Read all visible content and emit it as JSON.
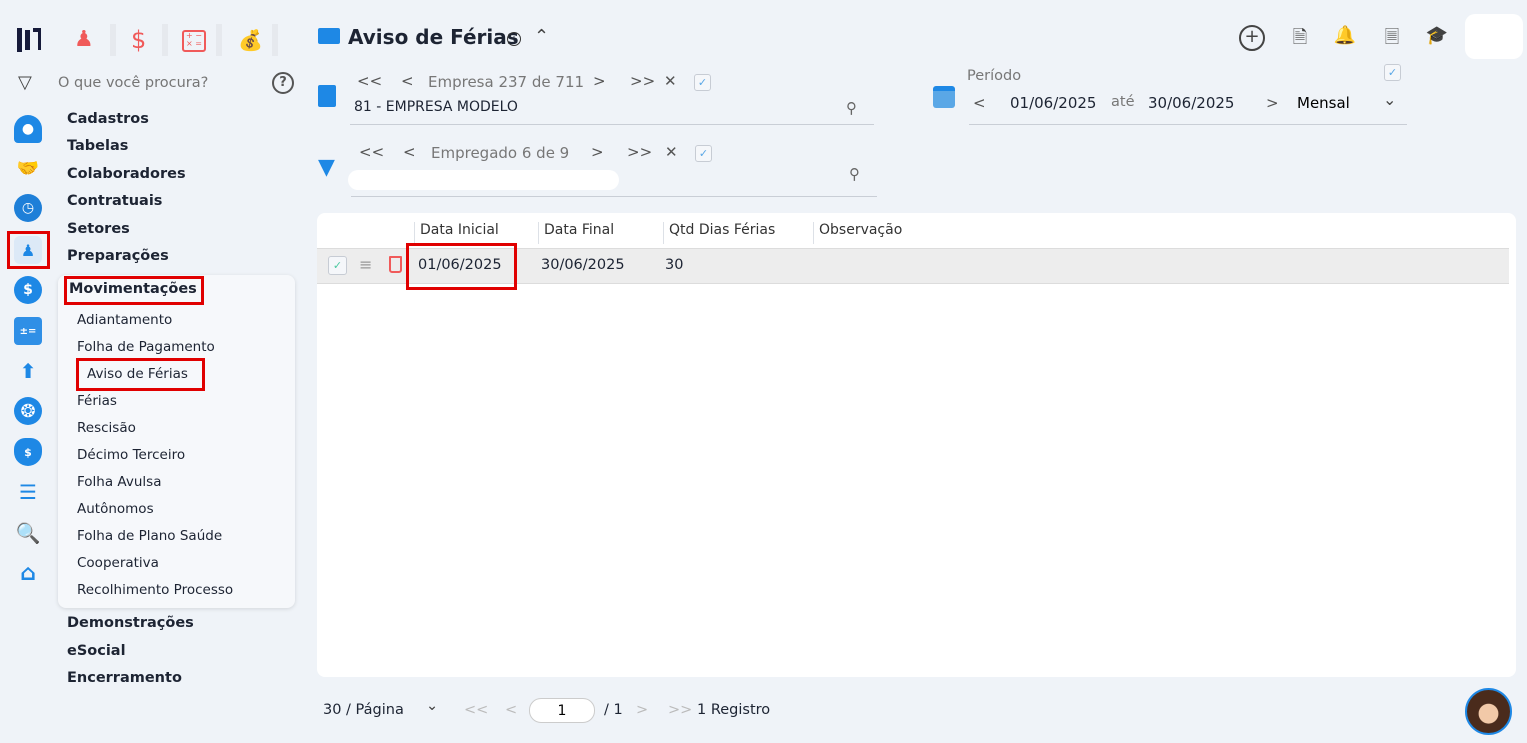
{
  "top_apps": [
    {
      "icon": "people-icon"
    },
    {
      "icon": "dollar-icon"
    },
    {
      "icon": "calculator-icon"
    },
    {
      "icon": "money-bag-icon"
    }
  ],
  "search": {
    "placeholder": "O que você procura?"
  },
  "menu": {
    "headers": [
      "Cadastros",
      "Tabelas",
      "Colaboradores",
      "Contratuais",
      "Setores",
      "Preparações"
    ],
    "active_section": "Movimentações",
    "sub_items": [
      "Adiantamento",
      "Folha de Pagamento",
      "Aviso de Férias",
      "Férias",
      "Rescisão",
      "Décimo Terceiro",
      "Folha Avulsa",
      "Autônomos",
      "Folha de Plano Saúde",
      "Cooperativa",
      "Recolhimento Processo"
    ],
    "footer_headers": [
      "Demonstrações",
      "eSocial",
      "Encerramento"
    ]
  },
  "header": {
    "title": "Aviso de Férias"
  },
  "empresa": {
    "nav_label": "Empresa",
    "current": "237",
    "sep": "de",
    "total": "711",
    "value": "81 - EMPRESA MODELO"
  },
  "empregado": {
    "nav_label": "Empregado 6 de 9",
    "value": ""
  },
  "periodo": {
    "label": "Período",
    "start": "01/06/2025",
    "sep": "até",
    "end": "30/06/2025",
    "mode": "Mensal"
  },
  "table": {
    "columns": [
      "Data Inicial",
      "Data Final",
      "Qtd Dias Férias",
      "Observação"
    ],
    "rows": [
      {
        "data_inicial": "01/06/2025",
        "data_final": "30/06/2025",
        "qtd": "30",
        "obs": ""
      }
    ]
  },
  "pagination": {
    "per_page": "30 / Página",
    "page": "1",
    "total_pages": "/ 1",
    "records": "1 Registro"
  },
  "colors": {
    "accent": "#1e88e5",
    "highlight": "#e00000",
    "danger": "#f05a5a"
  }
}
